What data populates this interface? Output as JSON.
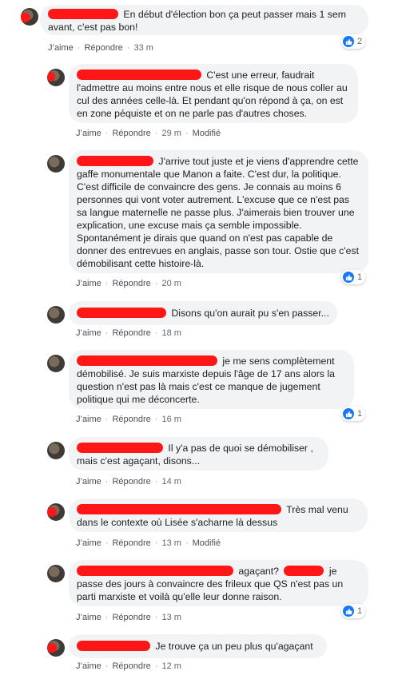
{
  "labels": {
    "like": "J’aime",
    "reply": "Répondre",
    "modified": "Modifié",
    "sep": "·"
  },
  "comments": [
    {
      "text": "En début d'élection bon ça peut passer mais 1 sem avant, c'est pas bon!",
      "time": "33 m",
      "reactions": "2"
    },
    {
      "text": "C'est une erreur, faudrait l'admettre au moins entre nous et elle risque de nous coller au cul des années celle-là. Et pendant qu'on répond à ça, on est en zone péquiste et on ne parle pas d'autres choses.",
      "time": "29 m",
      "modified": true
    },
    {
      "text": "J'arrive tout juste et je viens d'apprendre cette gaffe monumentale que Manon a faite. C'est dur, la politique. C'est difficile de convaincre des gens. Je connais au moins 6 personnes qui vont voter autrement. L'excuse que ce n'est pas sa langue maternelle ne passe plus. J'aimerais bien trouver une explication, une excuse mais ça semble impossible. Spontanément je dirais que quand on n'est pas capable de donner des entrevues en anglais, passe son tour. Ostie que c'est démobilisant cette histoire-là.",
      "time": "20 m",
      "reactions": "1"
    },
    {
      "text": "Disons qu'on aurait pu s'en passer...",
      "time": "18 m"
    },
    {
      "text": "je me sens complètement démobilisé. Je suis marxiste depuis l'âge de 17 ans alors la question n'est pas là mais c'est ce manque de jugement politique qui me déconcerte.",
      "time": "16 m",
      "reactions": "1"
    },
    {
      "text": "Il y'a pas de quoi se démobiliser , mais c'est agaçant, disons...",
      "time": "14 m"
    },
    {
      "text": "Très mal venu dans le contexte où Lisée s'acharne là dessus",
      "time": "13 m",
      "modified": true
    },
    {
      "text_a": "agaçant?",
      "text_b": "je passe des jours à convaincre des frileux que QS n'est pas un parti marxiste et voilà qu'elle leur donne raison.",
      "time": "13 m",
      "reactions": "1"
    },
    {
      "text": "Je trouve ça un peu plus qu'agaçant",
      "time": "12 m"
    }
  ]
}
